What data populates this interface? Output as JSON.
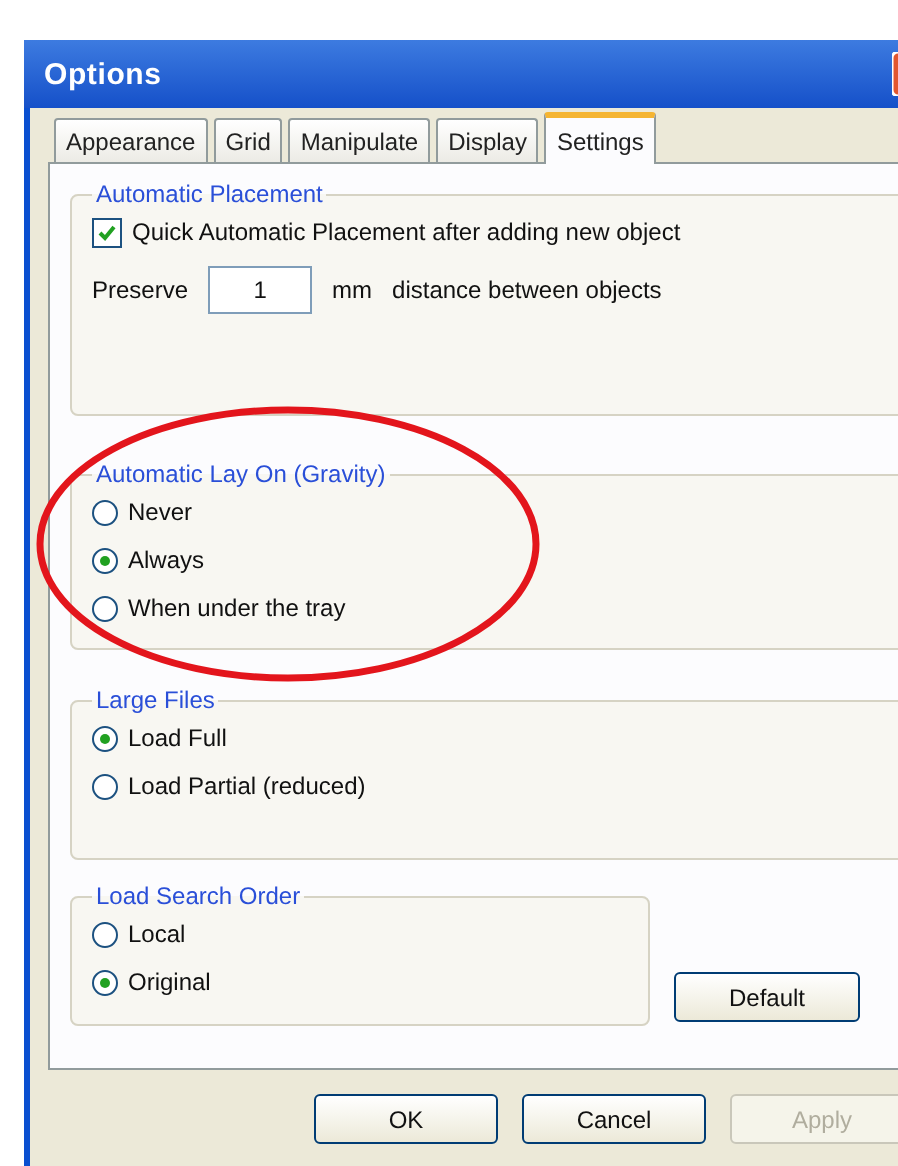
{
  "window": {
    "title": "Options"
  },
  "tabs": [
    {
      "label": "Appearance",
      "selected": false
    },
    {
      "label": "Grid",
      "selected": false
    },
    {
      "label": "Manipulate",
      "selected": false
    },
    {
      "label": "Display",
      "selected": false
    },
    {
      "label": "Settings",
      "selected": true
    }
  ],
  "groups": [
    {
      "title": "Automatic Placement",
      "items": [
        {
          "kind": "checkbox",
          "label": "Quick Automatic Placement after adding new object",
          "checked": true
        },
        {
          "kind": "number",
          "label": "Preserve",
          "value": "1",
          "unit": "mm",
          "suffix": "distance between objects"
        }
      ]
    },
    {
      "title": "Automatic Lay On (Gravity)",
      "items": [
        {
          "kind": "radio",
          "label": "Never",
          "selected": false
        },
        {
          "kind": "radio",
          "label": "Always",
          "selected": true
        },
        {
          "kind": "radio",
          "label": "When under the tray",
          "selected": false
        }
      ]
    },
    {
      "title": "Large Files",
      "items": [
        {
          "kind": "radio",
          "label": "Load Full",
          "selected": true
        },
        {
          "kind": "radio",
          "label": "Load Partial (reduced)",
          "selected": false
        }
      ]
    },
    {
      "title": "Load Search Order",
      "items": [
        {
          "kind": "radio",
          "label": "Local",
          "selected": false
        },
        {
          "kind": "radio",
          "label": "Original",
          "selected": true
        }
      ]
    }
  ],
  "default_button": {
    "label": "Default"
  },
  "buttons": [
    {
      "label": "OK",
      "disabled": false
    },
    {
      "label": "Cancel",
      "disabled": false
    },
    {
      "label": "Apply",
      "disabled": true
    }
  ]
}
